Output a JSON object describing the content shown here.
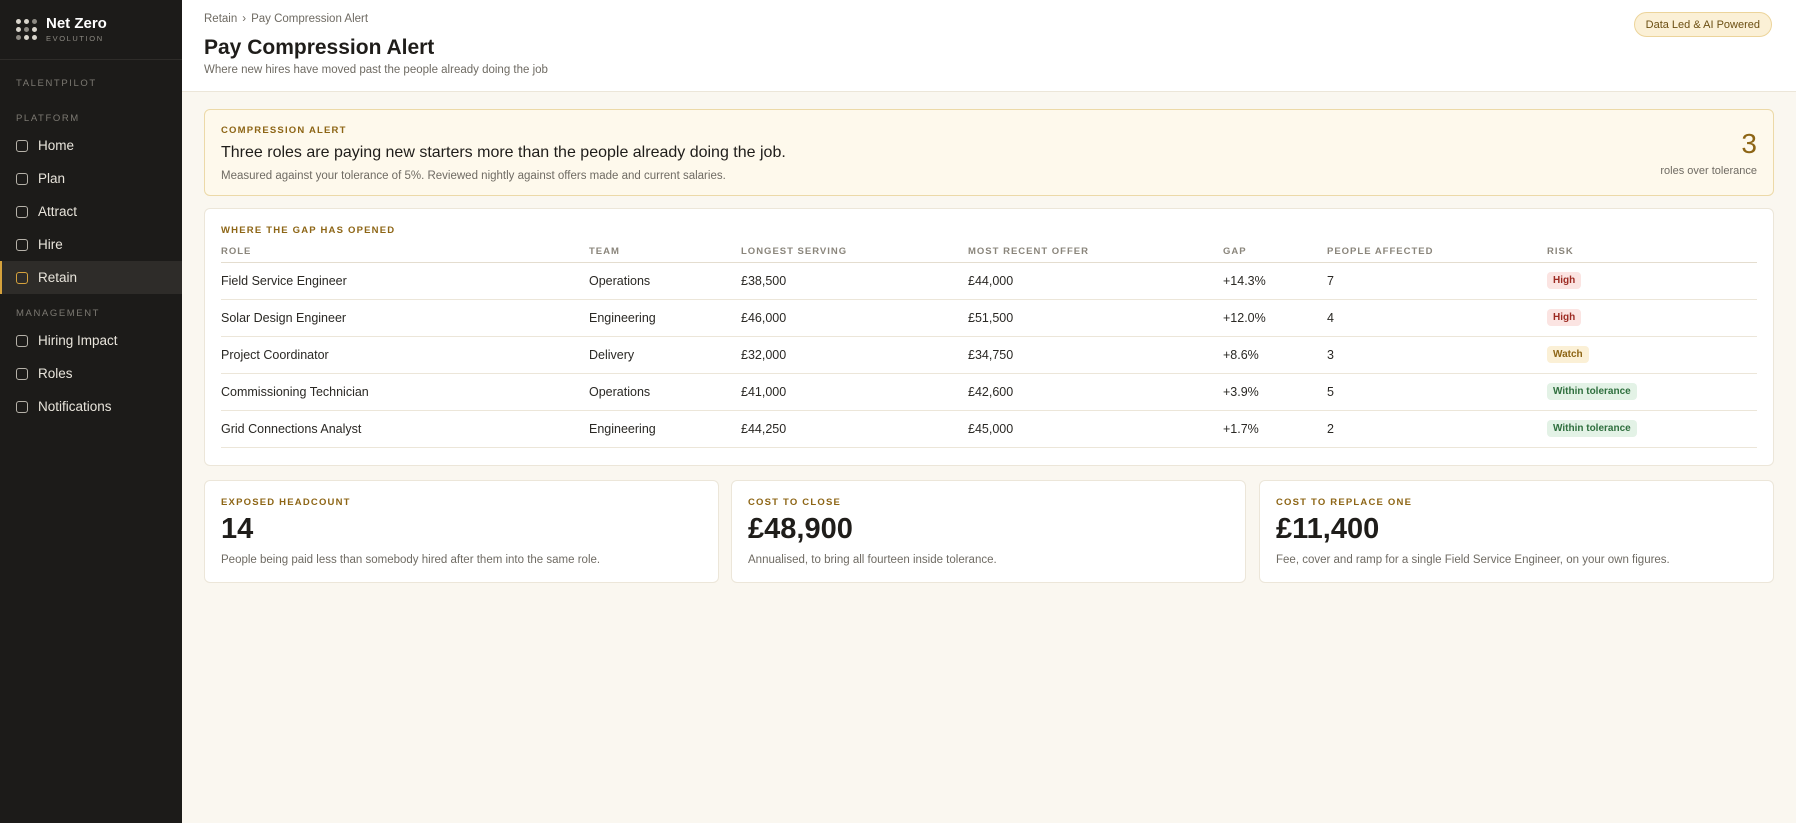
{
  "brand": {
    "name": "Net Zero",
    "sub": "EVOLUTION"
  },
  "sidebar": {
    "app_label": "TALENTPILOT",
    "platform_label": "PLATFORM",
    "platform_items": [
      {
        "label": "Home"
      },
      {
        "label": "Plan"
      },
      {
        "label": "Attract"
      },
      {
        "label": "Hire"
      },
      {
        "label": "Retain"
      }
    ],
    "management_label": "MANAGEMENT",
    "management_items": [
      {
        "label": "Hiring Impact"
      },
      {
        "label": "Roles"
      },
      {
        "label": "Notifications"
      }
    ]
  },
  "header": {
    "breadcrumb_parent": "Retain",
    "breadcrumb_sep": "›",
    "breadcrumb_current": "Pay Compression Alert",
    "title": "Pay Compression Alert",
    "subtitle": "Where new hires have moved past the people already doing the job",
    "badge": "Data Led & AI Powered"
  },
  "alert": {
    "eyebrow": "COMPRESSION ALERT",
    "headline": "Three roles are paying new starters more than the people already doing the job.",
    "detail": "Measured against your tolerance of 5%. Reviewed nightly against offers made and current salaries.",
    "count": "3",
    "count_label": "roles over tolerance"
  },
  "gap_table": {
    "eyebrow": "WHERE THE GAP HAS OPENED",
    "columns": [
      "ROLE",
      "TEAM",
      "LONGEST SERVING",
      "MOST RECENT OFFER",
      "GAP",
      "PEOPLE AFFECTED",
      "RISK"
    ],
    "rows": [
      {
        "role": "Field Service Engineer",
        "team": "Operations",
        "longest": "£38,500",
        "offer": "£44,000",
        "gap": "+14.3%",
        "people": "7",
        "risk": "High"
      },
      {
        "role": "Solar Design Engineer",
        "team": "Engineering",
        "longest": "£46,000",
        "offer": "£51,500",
        "gap": "+12.0%",
        "people": "4",
        "risk": "High"
      },
      {
        "role": "Project Coordinator",
        "team": "Delivery",
        "longest": "£32,000",
        "offer": "£34,750",
        "gap": "+8.6%",
        "people": "3",
        "risk": "Watch"
      },
      {
        "role": "Commissioning Technician",
        "team": "Operations",
        "longest": "£41,000",
        "offer": "£42,600",
        "gap": "+3.9%",
        "people": "5",
        "risk": "Within tolerance"
      },
      {
        "role": "Grid Connections Analyst",
        "team": "Engineering",
        "longest": "£44,250",
        "offer": "£45,000",
        "gap": "+1.7%",
        "people": "2",
        "risk": "Within tolerance"
      }
    ]
  },
  "stats": [
    {
      "label": "EXPOSED HEADCOUNT",
      "value": "14",
      "desc": "People being paid less than somebody hired after them into the same role."
    },
    {
      "label": "COST TO CLOSE",
      "value": "£48,900",
      "desc": "Annualised, to bring all fourteen inside tolerance."
    },
    {
      "label": "COST TO REPLACE ONE",
      "value": "£11,400",
      "desc": "Fee, cover and ramp for a single Field Service Engineer, on your own figures."
    }
  ]
}
